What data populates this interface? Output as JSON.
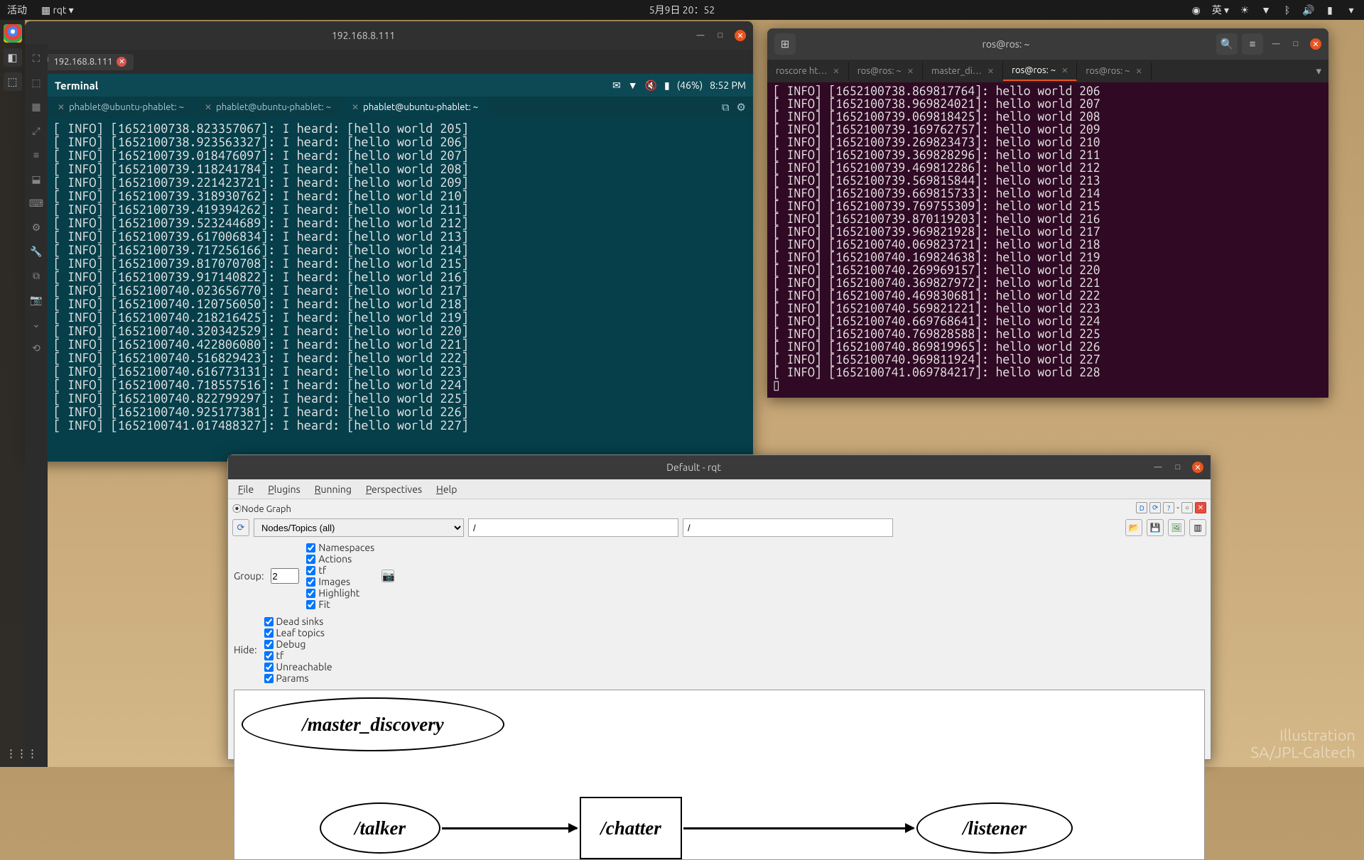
{
  "topbar": {
    "activities": "活动",
    "app": "rqt",
    "datetime": "5月9日 20：52",
    "ime": "英"
  },
  "dock": {
    "apps": [
      "chrome",
      "files",
      "settings",
      "terminal"
    ]
  },
  "remote": {
    "title": "192.168.8.111",
    "tab_label": "192.168.8.111",
    "phone": {
      "title": "Terminal",
      "battery": "(46%)",
      "time": "8:52 PM"
    },
    "tabs": [
      "phablet@ubuntu-phablet: ~",
      "phablet@ubuntu-phablet: ~",
      "phablet@ubuntu-phablet: ~"
    ],
    "active_tab": 2,
    "log": [
      "[ INFO] [1652100738.823357067]: I heard: [hello world 205]",
      "[ INFO] [1652100738.923563327]: I heard: [hello world 206]",
      "[ INFO] [1652100739.018476097]: I heard: [hello world 207]",
      "[ INFO] [1652100739.118241784]: I heard: [hello world 208]",
      "[ INFO] [1652100739.221423721]: I heard: [hello world 209]",
      "[ INFO] [1652100739.318930762]: I heard: [hello world 210]",
      "[ INFO] [1652100739.419394262]: I heard: [hello world 211]",
      "[ INFO] [1652100739.523244689]: I heard: [hello world 212]",
      "[ INFO] [1652100739.617006834]: I heard: [hello world 213]",
      "[ INFO] [1652100739.717256166]: I heard: [hello world 214]",
      "[ INFO] [1652100739.817070708]: I heard: [hello world 215]",
      "[ INFO] [1652100739.917140822]: I heard: [hello world 216]",
      "[ INFO] [1652100740.023656770]: I heard: [hello world 217]",
      "[ INFO] [1652100740.120756050]: I heard: [hello world 218]",
      "[ INFO] [1652100740.218216425]: I heard: [hello world 219]",
      "[ INFO] [1652100740.320342529]: I heard: [hello world 220]",
      "[ INFO] [1652100740.422806080]: I heard: [hello world 221]",
      "[ INFO] [1652100740.516829423]: I heard: [hello world 222]",
      "[ INFO] [1652100740.616773131]: I heard: [hello world 223]",
      "[ INFO] [1652100740.718557516]: I heard: [hello world 224]",
      "[ INFO] [1652100740.822799297]: I heard: [hello world 225]",
      "[ INFO] [1652100740.925177381]: I heard: [hello world 226]",
      "[ INFO] [1652100741.017488327]: I heard: [hello world 227]"
    ]
  },
  "gterm": {
    "title": "ros@ros: ~",
    "tabs": [
      "roscore ht…",
      "ros@ros: ~",
      "master_di…",
      "ros@ros: ~",
      "ros@ros: ~"
    ],
    "active_tab": 3,
    "log": [
      "[ INFO] [1652100738.869817764]: hello world 206",
      "[ INFO] [1652100738.969824021]: hello world 207",
      "[ INFO] [1652100739.069818425]: hello world 208",
      "[ INFO] [1652100739.169762757]: hello world 209",
      "[ INFO] [1652100739.269823473]: hello world 210",
      "[ INFO] [1652100739.369828296]: hello world 211",
      "[ INFO] [1652100739.469812286]: hello world 212",
      "[ INFO] [1652100739.569815844]: hello world 213",
      "[ INFO] [1652100739.669815733]: hello world 214",
      "[ INFO] [1652100739.769755309]: hello world 215",
      "[ INFO] [1652100739.870119203]: hello world 216",
      "[ INFO] [1652100739.969821928]: hello world 217",
      "[ INFO] [1652100740.069823721]: hello world 218",
      "[ INFO] [1652100740.169824638]: hello world 219",
      "[ INFO] [1652100740.269969157]: hello world 220",
      "[ INFO] [1652100740.369827972]: hello world 221",
      "[ INFO] [1652100740.469830681]: hello world 222",
      "[ INFO] [1652100740.569821221]: hello world 223",
      "[ INFO] [1652100740.669768641]: hello world 224",
      "[ INFO] [1652100740.769828588]: hello world 225",
      "[ INFO] [1652100740.869819965]: hello world 226",
      "[ INFO] [1652100740.969811924]: hello world 227",
      "[ INFO] [1652100741.069784217]: hello world 228"
    ]
  },
  "rqt": {
    "title": "Default - rqt",
    "menu": [
      "File",
      "Plugins",
      "Running",
      "Perspectives",
      "Help"
    ],
    "subtitle": "Node Graph",
    "combo": "Nodes/Topics (all)",
    "filter1": "/",
    "filter2": "/",
    "group_label": "Group:",
    "group_val": "2",
    "checks1": [
      "Namespaces",
      "Actions",
      "tf",
      "Images",
      "Highlight",
      "Fit"
    ],
    "hide_label": "Hide:",
    "checks2": [
      "Dead sinks",
      "Leaf topics",
      "Debug",
      "tf",
      "Unreachable",
      "Params"
    ],
    "nodes": {
      "master": "/master_discovery",
      "talker": "/talker",
      "chatter": "/chatter",
      "listener": "/listener"
    }
  },
  "watermark": {
    "l1": "Illustration",
    "l2": "SA/JPL-Caltech"
  }
}
